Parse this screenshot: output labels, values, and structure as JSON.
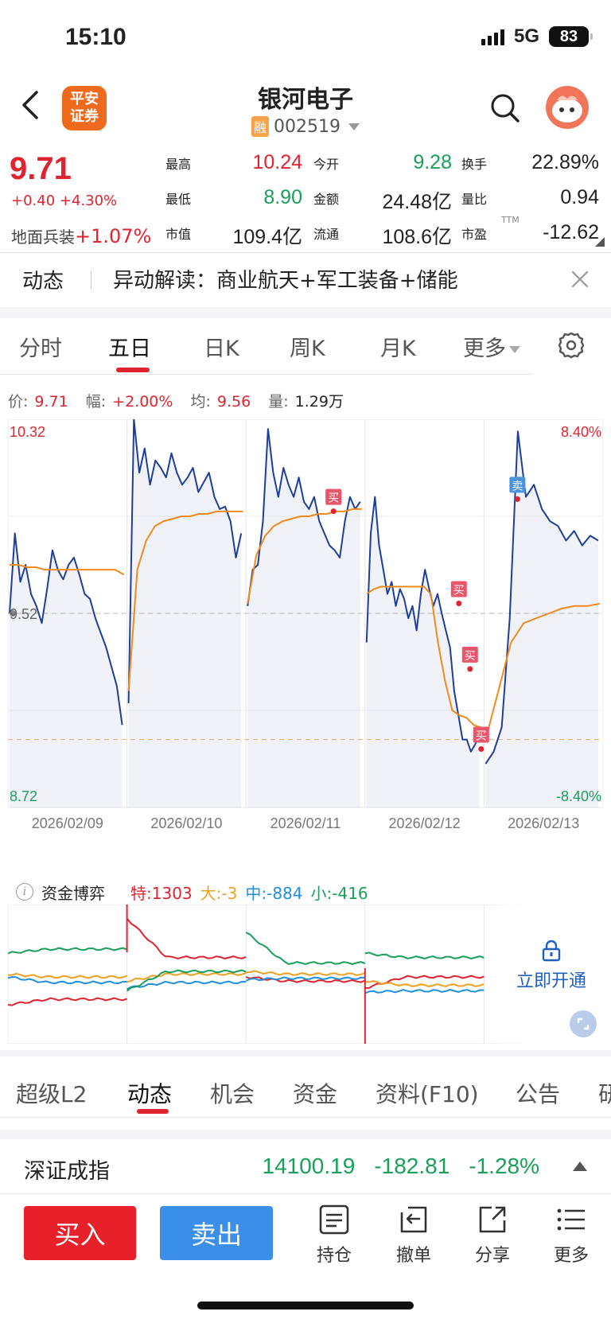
{
  "status": {
    "time": "15:10",
    "network": "5G",
    "battery": "83"
  },
  "header": {
    "broker_logo_line1": "平安",
    "broker_logo_line2": "证券",
    "stock_name": "银河电子",
    "margin_badge": "融",
    "stock_code": "002519"
  },
  "quote": {
    "price": "9.71",
    "change": "+0.40 +4.30%",
    "sector_name": "地面兵装",
    "sector_change": "+1.07%",
    "rows": [
      [
        {
          "label": "最高",
          "value": "10.24",
          "color": "#e0242f"
        },
        {
          "label": "今开",
          "value": "9.28",
          "color": "#18a05a"
        },
        {
          "label": "换手",
          "value": "22.89%",
          "color": "#222222"
        }
      ],
      [
        {
          "label": "最低",
          "value": "8.90",
          "color": "#18a05a"
        },
        {
          "label": "金额",
          "value": "24.48亿",
          "color": "#222222"
        },
        {
          "label": "量比",
          "value": "0.94",
          "color": "#222222"
        }
      ],
      [
        {
          "label": "市值",
          "value": "109.4亿",
          "color": "#222222"
        },
        {
          "label": "流通",
          "value": "108.6亿",
          "color": "#222222"
        },
        {
          "label": "市盈",
          "value": "-12.62",
          "color": "#222222",
          "sup": "TTM"
        }
      ]
    ]
  },
  "news": {
    "tag": "动态",
    "text": "异动解读：商业航天+军工装备+储能"
  },
  "chart_tabs": [
    "分时",
    "五日",
    "日K",
    "周K",
    "月K",
    "更多"
  ],
  "chart_tabs_active": "五日",
  "info": {
    "price_label": "价:",
    "price": "9.71",
    "range_label": "幅:",
    "range": "+2.00%",
    "avg_label": "均:",
    "avg": "9.56",
    "vol_label": "量:",
    "vol": "1.29万"
  },
  "chart_data": {
    "type": "line",
    "y_max_label": "10.32",
    "y_min_label": "8.72",
    "y_mid_label": "9.52",
    "pct_max_label": "8.40%",
    "pct_min_label": "-8.40%",
    "ylim": [
      8.72,
      10.32
    ],
    "prev_close": 9.52,
    "reference_line": 9.0,
    "x_labels": [
      "2026/02/09",
      "2026/02/10",
      "2026/02/11",
      "2026/02/12",
      "2026/02/13"
    ],
    "series": [
      {
        "color": "#1e3f99",
        "values": [
          [
            9.52,
            9.85,
            9.65,
            9.72,
            9.6,
            9.55,
            9.48,
            9.62,
            9.78,
            9.7,
            9.66,
            9.72,
            9.75,
            9.68,
            9.6,
            9.58,
            9.5,
            9.44,
            9.38,
            9.3,
            9.22,
            9.06
          ],
          [
            9.15,
            10.32,
            10.1,
            10.2,
            10.05,
            10.15,
            10.12,
            10.08,
            10.18,
            10.1,
            10.05,
            10.08,
            10.12,
            10.02,
            10.06,
            10.1,
            10.0,
            9.95,
            9.96,
            9.9,
            9.75,
            9.85
          ],
          [
            9.55,
            9.7,
            9.72,
            9.9,
            10.28,
            10.1,
            10.0,
            10.12,
            10.05,
            10.0,
            10.08,
            9.98,
            9.95,
            10.0,
            9.9,
            9.85,
            9.8,
            9.78,
            9.75,
            9.9,
            10.0,
            9.95,
            9.98
          ],
          [
            9.4,
            9.85,
            10.0,
            9.8,
            9.7,
            9.6,
            9.65,
            9.55,
            9.62,
            9.58,
            9.5,
            9.55,
            9.45,
            9.6,
            9.7,
            9.62,
            9.55,
            9.6,
            9.52,
            9.45,
            9.38,
            9.2,
            9.1,
            9.0,
            9.0,
            8.95,
            8.98,
            9.02
          ],
          [
            8.9,
            8.95,
            9.05,
            9.5,
            10.27,
            10.0,
            10.05,
            9.95,
            9.9,
            9.88,
            9.82,
            9.86,
            9.8,
            9.84,
            9.82
          ]
        ]
      },
      {
        "color": "#f08a1e",
        "values": [
          [
            9.72,
            9.72,
            9.71,
            9.71,
            9.7,
            9.7,
            9.7,
            9.7,
            9.7,
            9.7,
            9.7,
            9.7,
            9.7,
            9.68
          ],
          [
            9.2,
            9.7,
            9.82,
            9.88,
            9.9,
            9.91,
            9.92,
            9.92,
            9.93,
            9.93,
            9.94,
            9.94,
            9.94,
            9.94
          ],
          [
            9.56,
            9.76,
            9.84,
            9.88,
            9.9,
            9.91,
            9.92,
            9.92,
            9.93,
            9.93,
            9.94,
            9.94,
            9.95,
            9.95
          ],
          [
            9.6,
            9.62,
            9.63,
            9.63,
            9.63,
            9.63,
            9.63,
            9.63,
            9.63,
            9.6,
            9.4,
            9.24,
            9.12,
            9.1,
            9.09,
            9.06,
            9.05
          ],
          [
            9.0,
            9.2,
            9.4,
            9.48,
            9.5,
            9.52,
            9.54,
            9.55,
            9.55,
            9.56
          ]
        ]
      }
    ],
    "markers": [
      {
        "label": "买",
        "day": 2,
        "value": 10.0
      },
      {
        "label": "买",
        "day": 3,
        "value": 9.62
      },
      {
        "label": "买",
        "day": 3,
        "value": 9.35
      },
      {
        "label": "买",
        "day": 3,
        "value": 9.02
      },
      {
        "label": "卖",
        "day": 4,
        "value": 10.05
      }
    ]
  },
  "fund_flow": {
    "title": "资金博弈",
    "items": [
      {
        "label": "特:",
        "value": "1303",
        "color": "#e0242f"
      },
      {
        "label": "大:",
        "value": "-3",
        "color": "#f0a020"
      },
      {
        "label": "中:",
        "value": "-884",
        "color": "#1f8fe0"
      },
      {
        "label": "小:",
        "value": "-416",
        "color": "#18a05a"
      }
    ],
    "unlock_label": "立即开通"
  },
  "bottom_tabs": [
    "超级L2",
    "动态",
    "机会",
    "资金",
    "资料(F10)",
    "公告",
    "研"
  ],
  "bottom_tabs_active": "动态",
  "index": {
    "name": "深证成指",
    "value": "14100.19",
    "change": "-182.81",
    "pct": "-1.28%"
  },
  "actions": {
    "buy": "买入",
    "sell": "卖出",
    "items": [
      {
        "label": "持仓",
        "icon": "holdings-icon"
      },
      {
        "label": "撤单",
        "icon": "cancel-order-icon"
      },
      {
        "label": "分享",
        "icon": "share-icon"
      },
      {
        "label": "更多",
        "icon": "more-icon"
      }
    ]
  }
}
